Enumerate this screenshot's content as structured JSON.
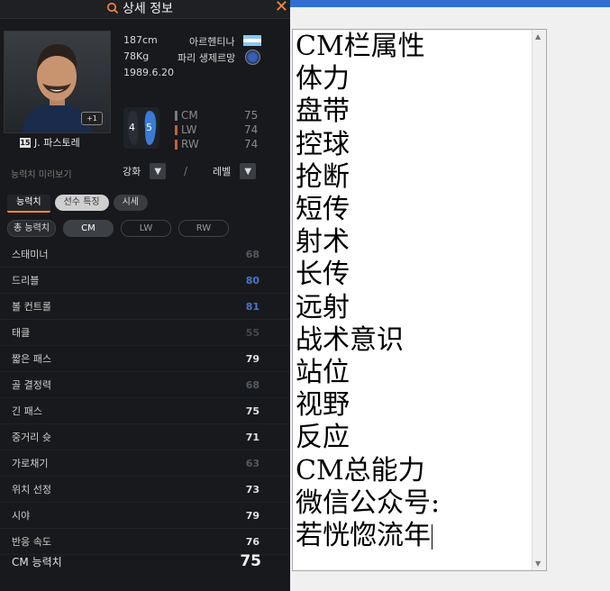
{
  "panel": {
    "title": "상세 정보",
    "close_symbol": "✕",
    "player": {
      "height": "187cm",
      "weight": "78Kg",
      "birthdate": "1989.6.20",
      "nationality": "아르헨티나",
      "club": "파리 생제르망",
      "name": "J. 파스토레",
      "season_badge": "15",
      "plus_label": "+1",
      "foot_left": "4",
      "foot_right": "5"
    },
    "positions": [
      {
        "name": "CM",
        "value": "75",
        "color": "#7a7a7a"
      },
      {
        "name": "LW",
        "value": "74",
        "color": "#c2603a"
      },
      {
        "name": "RW",
        "value": "74",
        "color": "#c2603a"
      }
    ],
    "preview": {
      "label": "능력치 미리보기",
      "enhance_label": "강화",
      "level_label": "레벨",
      "separator": "/"
    },
    "tabs": [
      "능력치",
      "선수 특징",
      "시세"
    ],
    "filters": {
      "total": "총 능력치",
      "options": [
        "CM",
        "LW",
        "RW"
      ]
    },
    "stats": [
      {
        "name": "스태미너",
        "value": "68",
        "color": "#555a60"
      },
      {
        "name": "드리블",
        "value": "80",
        "color": "#4a77c2"
      },
      {
        "name": "볼 컨트롤",
        "value": "81",
        "color": "#4a77c2"
      },
      {
        "name": "태클",
        "value": "55",
        "color": "#44484d"
      },
      {
        "name": "짧은 패스",
        "value": "79",
        "color": "#e0e0e0"
      },
      {
        "name": "골 결정력",
        "value": "68",
        "color": "#555a60"
      },
      {
        "name": "긴 패스",
        "value": "75",
        "color": "#e0e0e0"
      },
      {
        "name": "중거리 슛",
        "value": "71",
        "color": "#e0e0e0"
      },
      {
        "name": "가로채기",
        "value": "63",
        "color": "#555a60"
      },
      {
        "name": "위치 선정",
        "value": "73",
        "color": "#e0e0e0"
      },
      {
        "name": "시야",
        "value": "79",
        "color": "#e0e0e0"
      },
      {
        "name": "반응 속도",
        "value": "76",
        "color": "#e0e0e0"
      }
    ],
    "total": {
      "label": "CM 능력치",
      "value": "75"
    }
  },
  "notepad": {
    "lines": [
      "CM栏属性",
      "体力",
      "盘带",
      "控球",
      "抢断",
      "短传",
      "射术",
      "长传",
      "远射",
      "战术意识",
      "站位",
      "视野",
      "反应",
      "CM总能力",
      "微信公众号:",
      "若恍惚流年"
    ]
  },
  "colors": {
    "accent": "#ff8a3c",
    "window_bar": "#2f6fd6"
  }
}
